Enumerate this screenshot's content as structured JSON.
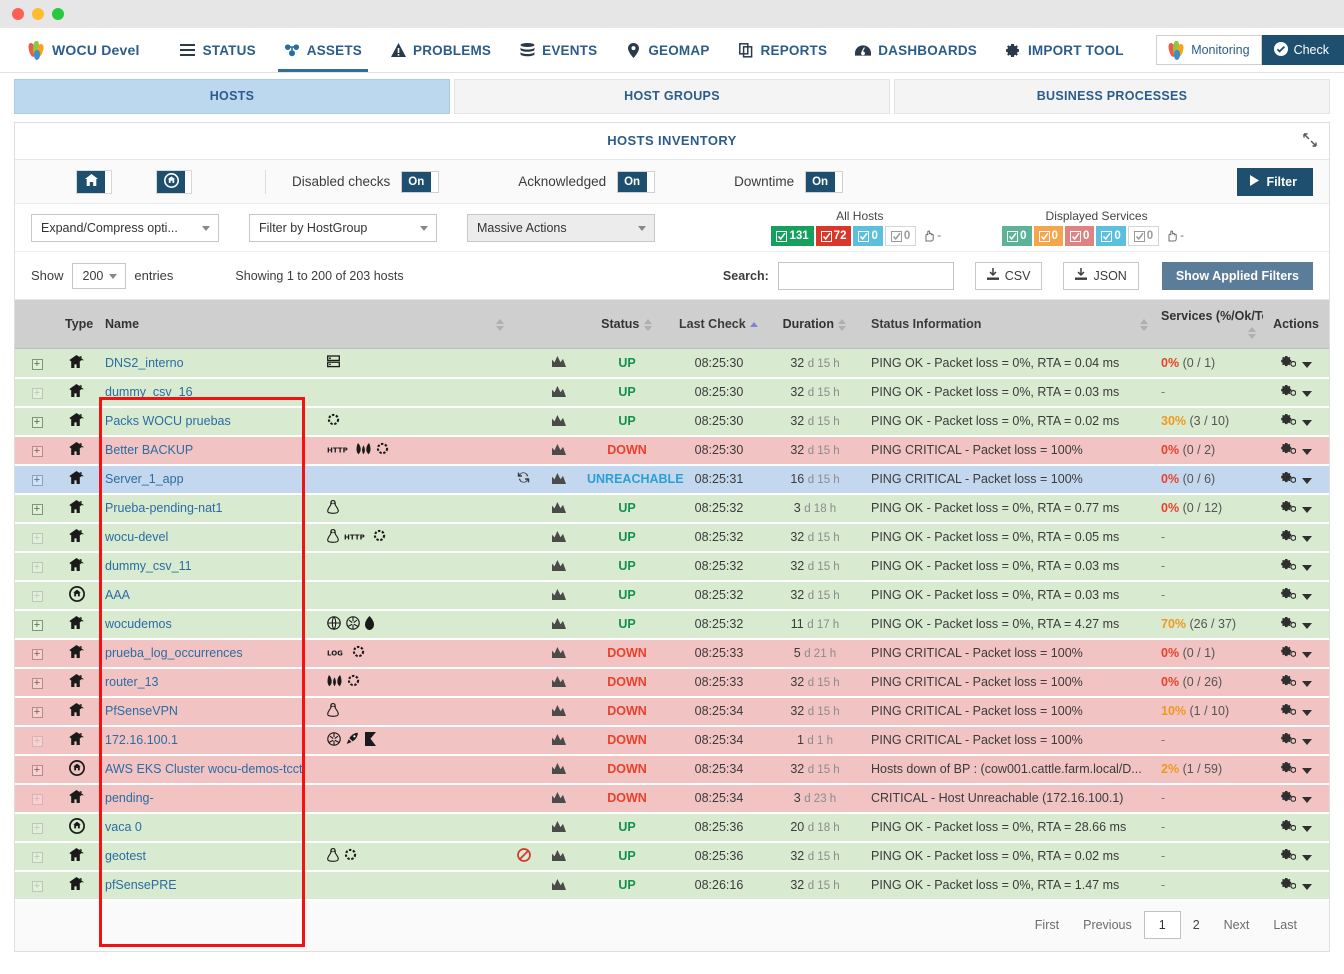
{
  "nav": {
    "brand": "WOCU Devel",
    "items": [
      {
        "label": "STATUS",
        "icon": "list-icon",
        "active": false
      },
      {
        "label": "ASSETS",
        "icon": "assets-icon",
        "active": true
      },
      {
        "label": "PROBLEMS",
        "icon": "warning-triangle-icon",
        "active": false
      },
      {
        "label": "EVENTS",
        "icon": "database-stack-icon",
        "active": false
      },
      {
        "label": "GEOMAP",
        "icon": "map-pin-icon",
        "active": false
      },
      {
        "label": "REPORTS",
        "icon": "copy-pages-icon",
        "active": false
      },
      {
        "label": "DASHBOARDS",
        "icon": "dashboard-gauge-icon",
        "active": false
      },
      {
        "label": "IMPORT TOOL",
        "icon": "gear-icon",
        "active": false
      }
    ],
    "monitoring_button": "Monitoring",
    "check_button": "Check"
  },
  "subtabs": [
    {
      "label": "HOSTS",
      "active": true
    },
    {
      "label": "HOST GROUPS",
      "active": false
    },
    {
      "label": "BUSINESS PROCESSES",
      "active": false
    }
  ],
  "panel": {
    "title": "HOSTS INVENTORY"
  },
  "toolbar": {
    "home_button_icon": "home-icon",
    "bp_button_icon": "business-process-icon",
    "toggles": [
      {
        "label": "Disabled checks",
        "value": "On"
      },
      {
        "label": "Acknowledged",
        "value": "On"
      },
      {
        "label": "Downtime",
        "value": "On"
      }
    ],
    "filter_button": "Filter",
    "selects": [
      {
        "value": "Expand/Compress opti...",
        "name": "expand-compress-select"
      },
      {
        "value": "Filter by HostGroup",
        "name": "filter-hostgroup-select"
      },
      {
        "value": "Massive Actions",
        "name": "massive-actions-select"
      }
    ],
    "counters": [
      {
        "title": "All Hosts",
        "badges": [
          {
            "value": "131",
            "color": "#16a05e",
            "style": "solid"
          },
          {
            "value": "72",
            "color": "#d9372b",
            "style": "solid"
          },
          {
            "value": "0",
            "color": "#5bc0de",
            "style": "solid"
          },
          {
            "value": "0",
            "color": "#ffffff",
            "style": "grey"
          },
          {
            "value": "-",
            "color": "",
            "style": "plain"
          }
        ]
      },
      {
        "title": "Displayed Services",
        "badges": [
          {
            "value": "0",
            "color": "#5cb398",
            "style": "solid"
          },
          {
            "value": "0",
            "color": "#f5a54a",
            "style": "solid"
          },
          {
            "value": "0",
            "color": "#e08282",
            "style": "solid"
          },
          {
            "value": "0",
            "color": "#5bc0de",
            "style": "solid"
          },
          {
            "value": "0",
            "color": "#ffffff",
            "style": "grey"
          },
          {
            "value": "-",
            "color": "",
            "style": "plain"
          }
        ]
      }
    ]
  },
  "controls": {
    "show_label": "Show",
    "entries_value": "200",
    "entries_label": "entries",
    "showing_info": "Showing 1 to 200 of 203 hosts",
    "search_label": "Search:",
    "search_value": "",
    "search_placeholder": "",
    "csv_button": "CSV",
    "json_button": "JSON",
    "applied_filters_button": "Show Applied Filters"
  },
  "table": {
    "columns": [
      {
        "label": "Type",
        "sort": "none"
      },
      {
        "label": "Name",
        "sort": "none"
      },
      {
        "label": "Status",
        "sort": "none"
      },
      {
        "label": "Last Check",
        "sort": "asc"
      },
      {
        "label": "Duration",
        "sort": "none"
      },
      {
        "label": "Status Information",
        "sort": "none"
      },
      {
        "label": "Services (%/Ok/Total)",
        "sort": "none"
      },
      {
        "label": "Actions",
        "sort": "none"
      }
    ],
    "rows": [
      {
        "expander": "plus",
        "type": "host-icon",
        "name": "DNS2_interno",
        "icons": [
          "server-rack-icon"
        ],
        "ack": "",
        "status": "UP",
        "state": "up",
        "last_check": "08:25:30",
        "dur_num": "32",
        "dur_unit": "d 15 h",
        "info": "PING OK - Packet loss = 0%, RTA = 0.04 ms",
        "pct": "0%",
        "pct_color": "red",
        "counts": "(0 / 1)"
      },
      {
        "expander": "plus-dim",
        "type": "host-icon",
        "name": "dummy_csv_16",
        "icons": [],
        "ack": "",
        "status": "UP",
        "state": "up",
        "last_check": "08:25:30",
        "dur_num": "32",
        "dur_unit": "d 15 h",
        "info": "PING OK - Packet loss = 0%, RTA = 0.03 ms",
        "pct": "",
        "pct_color": "",
        "counts": "-"
      },
      {
        "expander": "plus",
        "type": "host-icon",
        "name": "Packs WOCU pruebas",
        "icons": [
          "gear-dashed-icon"
        ],
        "ack": "",
        "status": "UP",
        "state": "up",
        "last_check": "08:25:30",
        "dur_num": "32",
        "dur_unit": "d 15 h",
        "info": "PING OK - Packet loss = 0%, RTA = 0.02 ms",
        "pct": "30%",
        "pct_color": "orange",
        "counts": "(3 / 10)"
      },
      {
        "expander": "plus",
        "type": "host-icon",
        "name": "Better BACKUP",
        "icons": [
          "http-icon",
          "huawei-icon",
          "gear-dashed-icon"
        ],
        "ack": "",
        "status": "DOWN",
        "state": "down",
        "last_check": "08:25:30",
        "dur_num": "32",
        "dur_unit": "d 15 h",
        "info": "PING CRITICAL - Packet loss = 100%",
        "pct": "0%",
        "pct_color": "red",
        "counts": "(0 / 2)"
      },
      {
        "expander": "plus",
        "type": "host-icon",
        "name": "Server_1_app",
        "icons": [],
        "ack": "refresh-icon",
        "status": "UNREACHABLE",
        "state": "unreach",
        "last_check": "08:25:31",
        "dur_num": "16",
        "dur_unit": "d 15 h",
        "info": "PING CRITICAL - Packet loss = 100%",
        "pct": "0%",
        "pct_color": "red",
        "counts": "(0 / 6)"
      },
      {
        "expander": "plus",
        "type": "host-icon",
        "name": "Prueba-pending-nat1",
        "icons": [
          "linux-tux-icon"
        ],
        "ack": "",
        "status": "UP",
        "state": "up",
        "last_check": "08:25:32",
        "dur_num": "3",
        "dur_unit": "d 18 h",
        "info": "PING OK - Packet loss = 0%, RTA = 0.77 ms",
        "pct": "0%",
        "pct_color": "red",
        "counts": "(0 / 12)"
      },
      {
        "expander": "plus-dim",
        "type": "host-icon",
        "name": "wocu-devel",
        "icons": [
          "linux-tux-icon",
          "http-icon",
          "gear-dashed-icon"
        ],
        "ack": "",
        "status": "UP",
        "state": "up",
        "last_check": "08:25:32",
        "dur_num": "32",
        "dur_unit": "d 15 h",
        "info": "PING OK - Packet loss = 0%, RTA = 0.05 ms",
        "pct": "",
        "pct_color": "",
        "counts": "-"
      },
      {
        "expander": "plus-dim",
        "type": "host-icon",
        "name": "dummy_csv_11",
        "icons": [],
        "ack": "",
        "status": "UP",
        "state": "up",
        "last_check": "08:25:32",
        "dur_num": "32",
        "dur_unit": "d 15 h",
        "info": "PING OK - Packet loss = 0%, RTA = 0.03 ms",
        "pct": "",
        "pct_color": "",
        "counts": "-"
      },
      {
        "expander": "plus-dim",
        "type": "bp-icon",
        "name": "AAA",
        "icons": [],
        "ack": "",
        "status": "UP",
        "state": "up",
        "last_check": "08:25:32",
        "dur_num": "32",
        "dur_unit": "d 15 h",
        "info": "PING OK - Packet loss = 0%, RTA = 0.03 ms",
        "pct": "",
        "pct_color": "",
        "counts": "-"
      },
      {
        "expander": "plus",
        "type": "host-icon",
        "name": "wocudemos",
        "icons": [
          "globe-icon",
          "cluster-icon",
          "leaf-icon"
        ],
        "ack": "",
        "status": "UP",
        "state": "up",
        "last_check": "08:25:32",
        "dur_num": "11",
        "dur_unit": "d 17 h",
        "info": "PING OK - Packet loss = 0%, RTA = 4.27 ms",
        "pct": "70%",
        "pct_color": "orange",
        "counts": "(26 / 37)"
      },
      {
        "expander": "plus",
        "type": "host-icon",
        "name": "prueba_log_occurrences",
        "icons": [
          "log-icon",
          "gear-dashed-icon"
        ],
        "ack": "",
        "status": "DOWN",
        "state": "down",
        "last_check": "08:25:33",
        "dur_num": "5",
        "dur_unit": "d 21 h",
        "info": "PING CRITICAL - Packet loss = 100%",
        "pct": "0%",
        "pct_color": "red",
        "counts": "(0 / 1)"
      },
      {
        "expander": "plus",
        "type": "host-icon",
        "name": "router_13",
        "icons": [
          "huawei-icon",
          "gear-dashed-icon"
        ],
        "ack": "",
        "status": "DOWN",
        "state": "down",
        "last_check": "08:25:33",
        "dur_num": "32",
        "dur_unit": "d 15 h",
        "info": "PING CRITICAL - Packet loss = 100%",
        "pct": "0%",
        "pct_color": "red",
        "counts": "(0 / 26)"
      },
      {
        "expander": "plus",
        "type": "host-icon",
        "name": "PfSenseVPN",
        "icons": [
          "linux-tux-icon"
        ],
        "ack": "",
        "status": "DOWN",
        "state": "down",
        "last_check": "08:25:34",
        "dur_num": "32",
        "dur_unit": "d 15 h",
        "info": "PING CRITICAL - Packet loss = 100%",
        "pct": "10%",
        "pct_color": "orange",
        "counts": "(1 / 10)"
      },
      {
        "expander": "plus-dim",
        "type": "host-icon",
        "name": "172.16.100.1",
        "icons": [
          "cluster-icon",
          "rocket-icon",
          "flag-icon"
        ],
        "ack": "",
        "status": "DOWN",
        "state": "down",
        "last_check": "08:25:34",
        "dur_num": "1",
        "dur_unit": "d 1 h",
        "info": "PING CRITICAL - Packet loss = 100%",
        "pct": "",
        "pct_color": "",
        "counts": "-"
      },
      {
        "expander": "plus",
        "type": "bp-icon",
        "name": "AWS EKS Cluster wocu-demos-tcct",
        "icons": [],
        "ack": "",
        "status": "DOWN",
        "state": "down",
        "last_check": "08:25:34",
        "dur_num": "32",
        "dur_unit": "d 15 h",
        "info": "Hosts down of BP : (cow001.cattle.farm.local/D...",
        "pct": "2%",
        "pct_color": "orange",
        "counts": "(1 / 59)"
      },
      {
        "expander": "plus-dim",
        "type": "host-icon",
        "name": "pending-",
        "icons": [],
        "ack": "",
        "status": "DOWN",
        "state": "down",
        "last_check": "08:25:34",
        "dur_num": "3",
        "dur_unit": "d 23 h",
        "info": "CRITICAL - Host Unreachable (172.16.100.1)",
        "pct": "",
        "pct_color": "",
        "counts": "-"
      },
      {
        "expander": "plus-dim",
        "type": "bp-icon",
        "name": "vaca 0",
        "icons": [],
        "ack": "",
        "status": "UP",
        "state": "up",
        "last_check": "08:25:36",
        "dur_num": "20",
        "dur_unit": "d 18 h",
        "info": "PING OK - Packet loss = 0%, RTA = 28.66 ms",
        "pct": "",
        "pct_color": "",
        "counts": "-"
      },
      {
        "expander": "plus-dim",
        "type": "host-icon",
        "name": "geotest",
        "icons": [
          "linux-tux-icon",
          "gear-dashed-icon"
        ],
        "ack": "disabled-icon",
        "status": "UP",
        "state": "up",
        "last_check": "08:25:36",
        "dur_num": "32",
        "dur_unit": "d 15 h",
        "info": "PING OK - Packet loss = 0%, RTA = 0.02 ms",
        "pct": "",
        "pct_color": "",
        "counts": "-"
      },
      {
        "expander": "plus-dim",
        "type": "host-icon",
        "name": "pfSensePRE",
        "icons": [],
        "ack": "",
        "status": "UP",
        "state": "up",
        "last_check": "08:26:16",
        "dur_num": "32",
        "dur_unit": "d 15 h",
        "info": "PING OK - Packet loss = 0%, RTA = 1.47 ms",
        "pct": "",
        "pct_color": "",
        "counts": "-"
      }
    ]
  },
  "pagination": {
    "first": "First",
    "previous": "Previous",
    "pages": [
      "1",
      "2"
    ],
    "current": "1",
    "next": "Next",
    "last": "Last"
  }
}
